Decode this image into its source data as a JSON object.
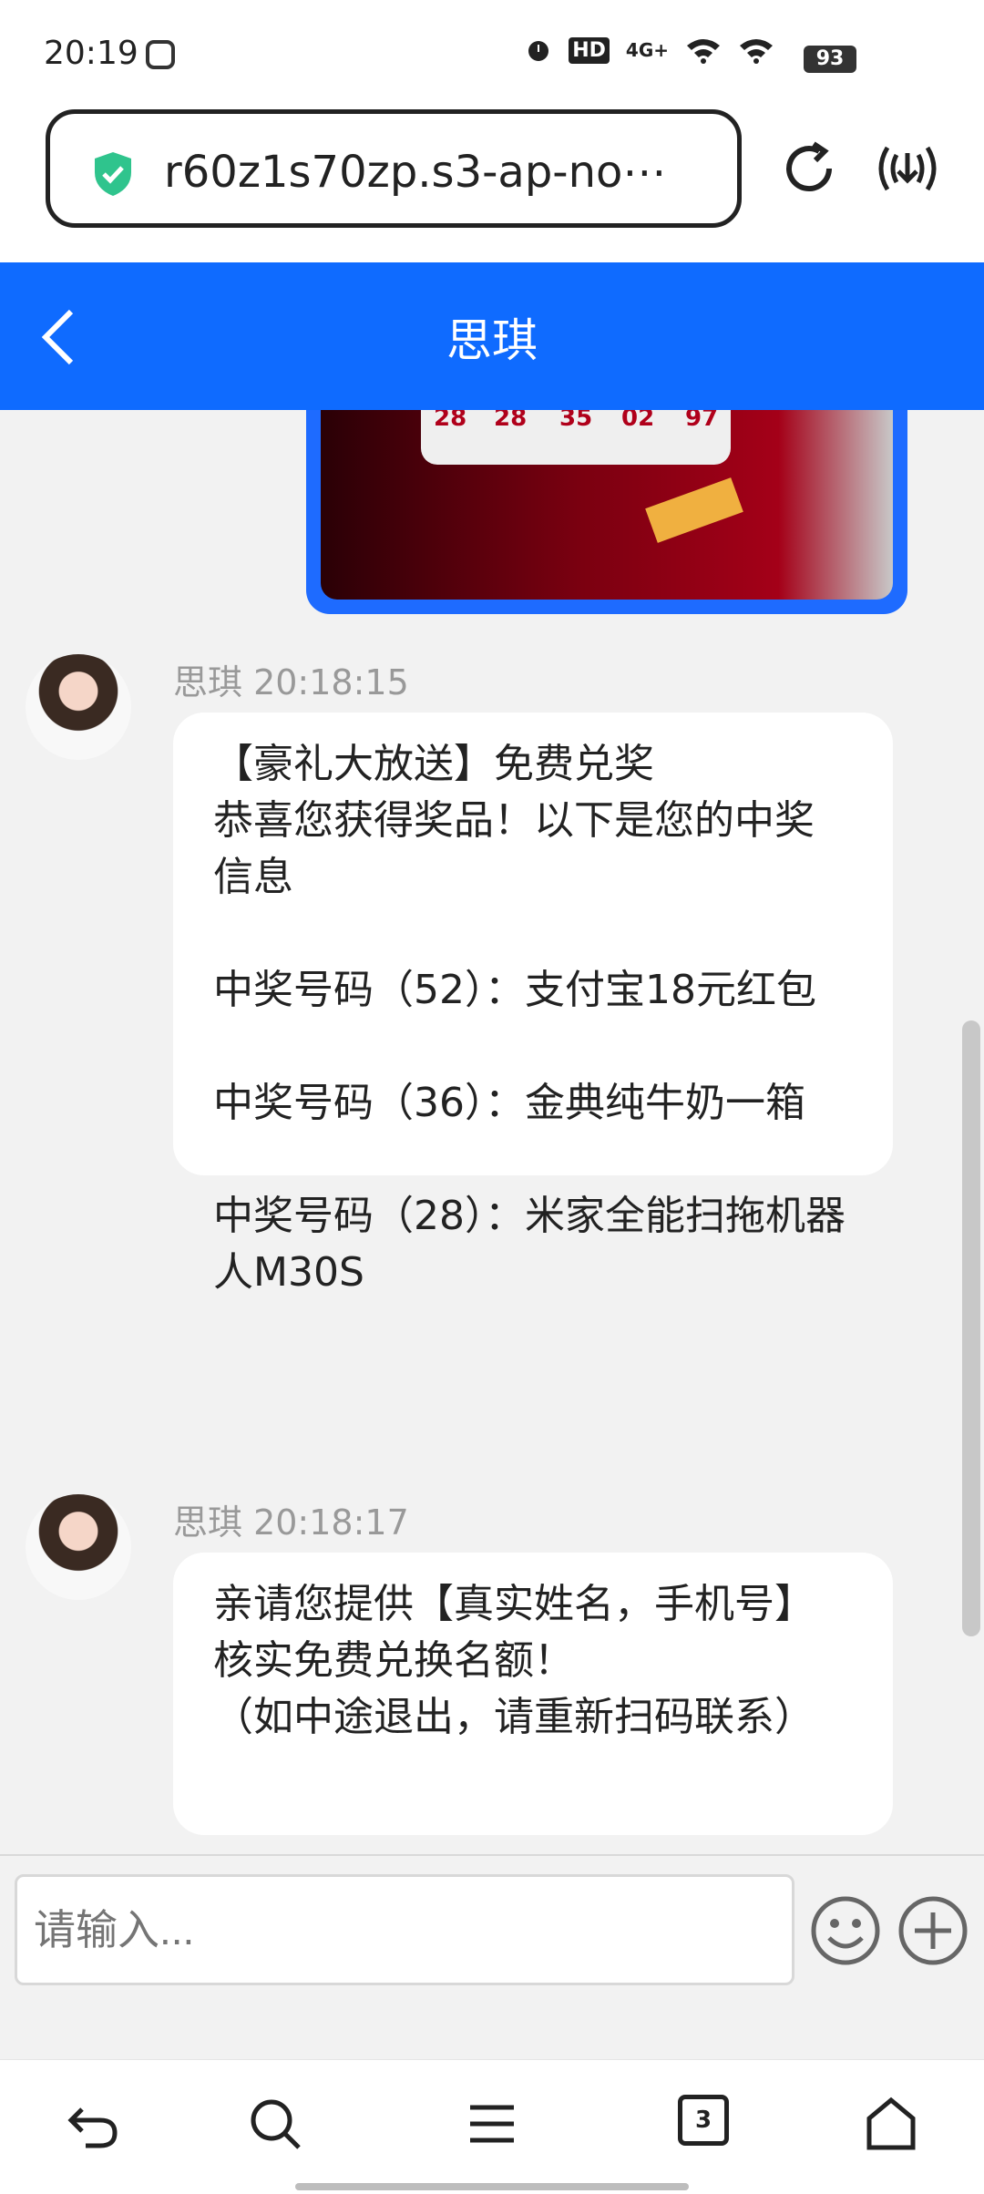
{
  "status_bar": {
    "time": "20:19",
    "signal_label": "4G+",
    "hd_label": "HD",
    "battery": "93"
  },
  "url_bar": {
    "url": "r60z1s70zp.s3-ap-no⋯"
  },
  "header": {
    "title": "思琪"
  },
  "image_message": {
    "numbers": [
      "28",
      "28",
      "35",
      "02",
      "97"
    ]
  },
  "messages": [
    {
      "sender": "思琪",
      "time": "20:18:15",
      "meta": "思琪 20:18:15",
      "text": "【豪礼大放送】免费兑奖\n恭喜您获得奖品！以下是您的中奖信息\n\n中奖号码（52）：支付宝18元红包\n\n中奖号码（36）：金典纯牛奶一箱\n\n中奖号码（28）：米家全能扫拖机器人M30S"
    },
    {
      "sender": "思琪",
      "time": "20:18:17",
      "meta": "思琪 20:18:17",
      "text": "亲请您提供【真实姓名，手机号】核实免费兑换名额！\n（如中途退出，请重新扫码联系）"
    }
  ],
  "input": {
    "placeholder": "请输入..."
  },
  "nav": {
    "tabs_count": "3"
  },
  "colors": {
    "header_bg": "#0f6bff",
    "chat_bg": "#f2f2f2",
    "bubble_bg": "#ffffff"
  }
}
